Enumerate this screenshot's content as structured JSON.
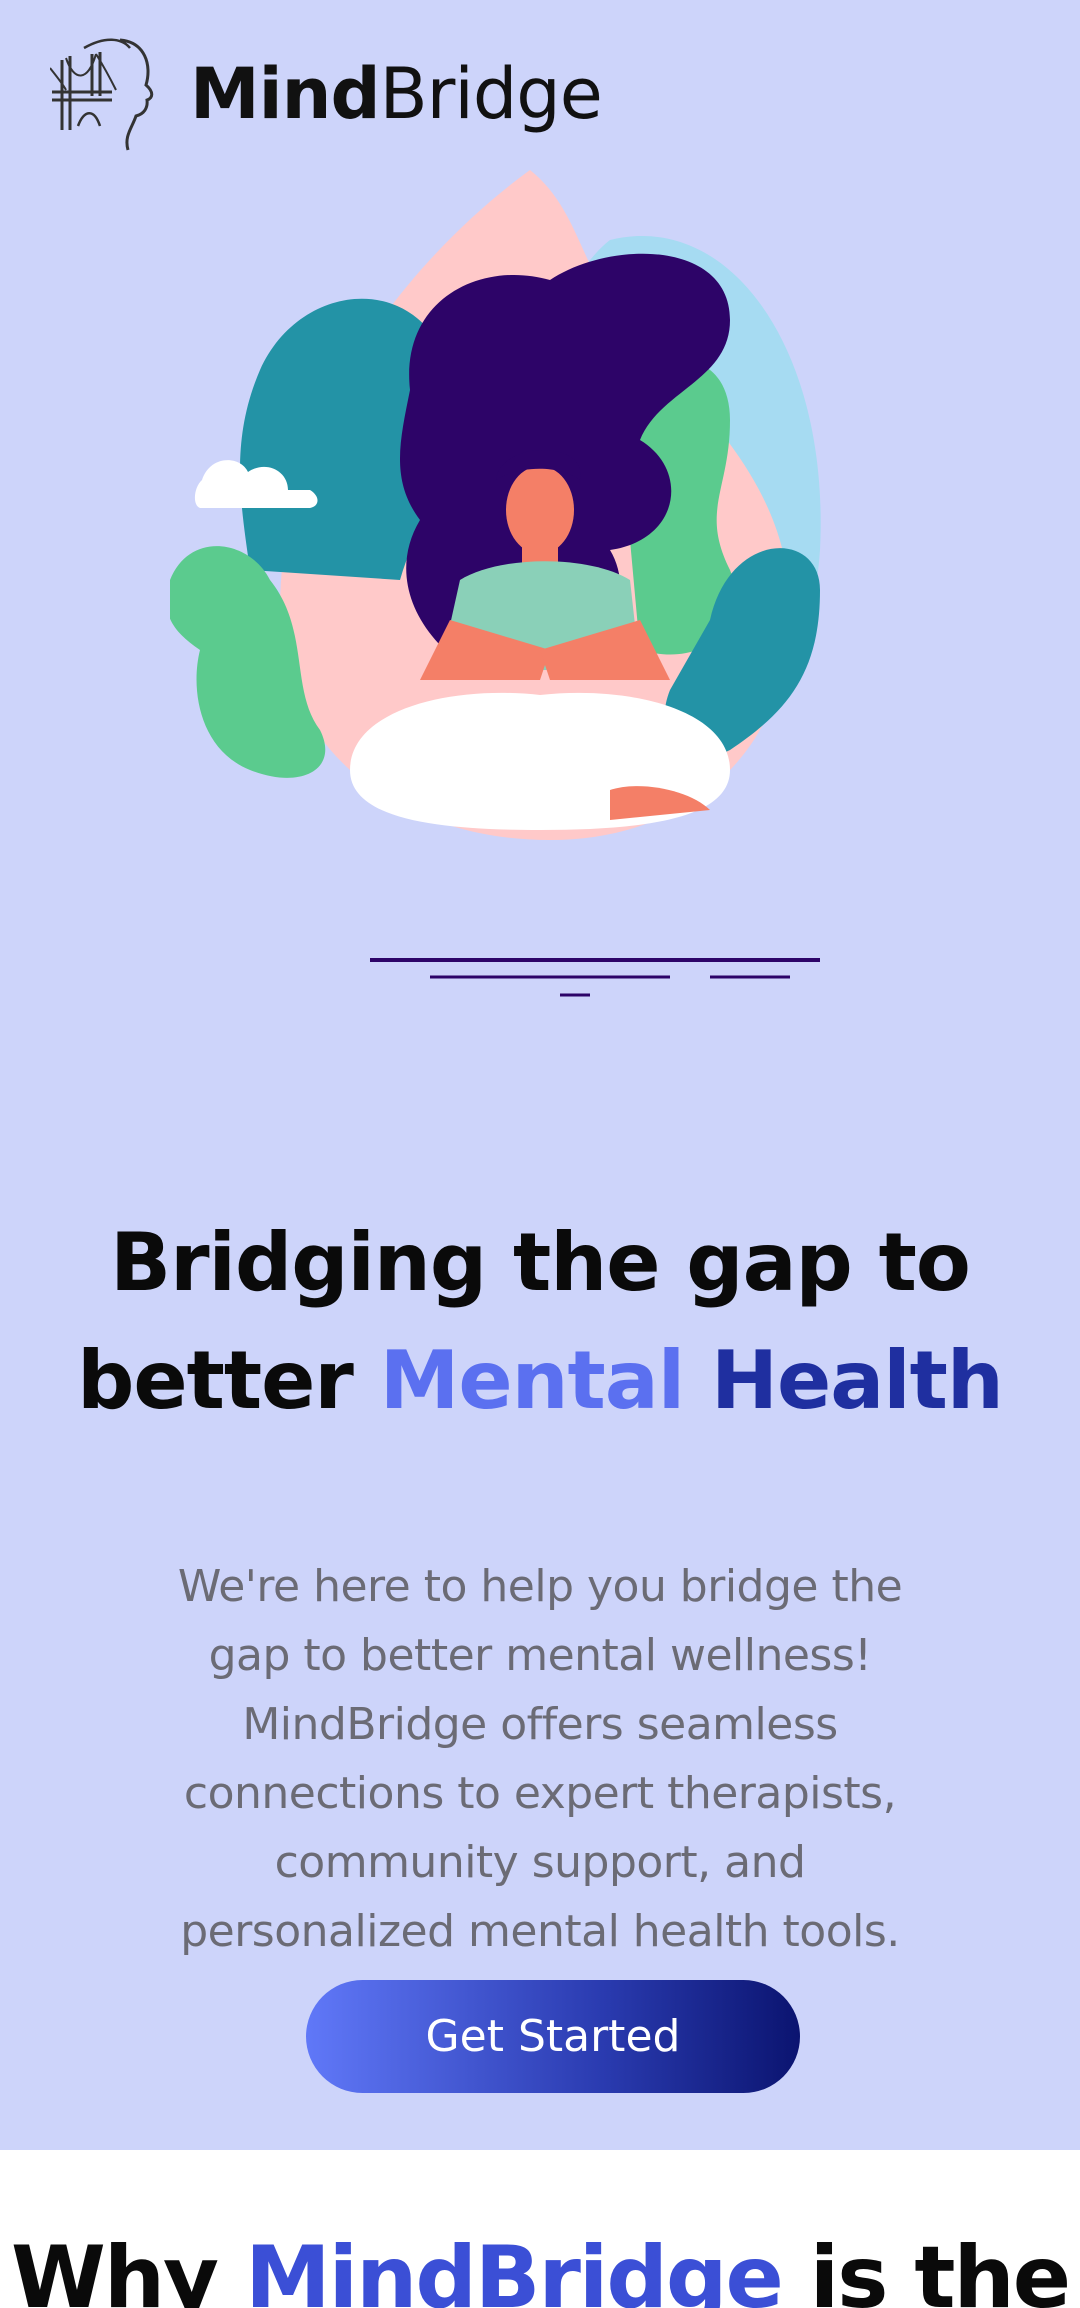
{
  "brand": {
    "name_bold": "Mind",
    "name_regular": "Bridge"
  },
  "hero": {
    "headline": {
      "part1": "Bridging the gap to better",
      "highlight1": "Mental",
      "highlight2": "Health"
    },
    "description": "We're here to help you bridge the gap to better mental wellness! MindBridge offers seamless connections to expert therapists, community support, and personalized mental health tools.",
    "cta_label": "Get Started"
  },
  "why_section": {
    "prefix": "Why",
    "brand": "MindBridge",
    "suffix": "is the"
  },
  "colors": {
    "hero_bg": "#cdd4fa",
    "accent_light": "#5b70f0",
    "accent_dark": "#1f2fa0",
    "text_muted": "#6b6b75"
  },
  "icons": {
    "logo": "bridge-head-logo-icon",
    "illustration": "meditating-woman-illustration"
  }
}
